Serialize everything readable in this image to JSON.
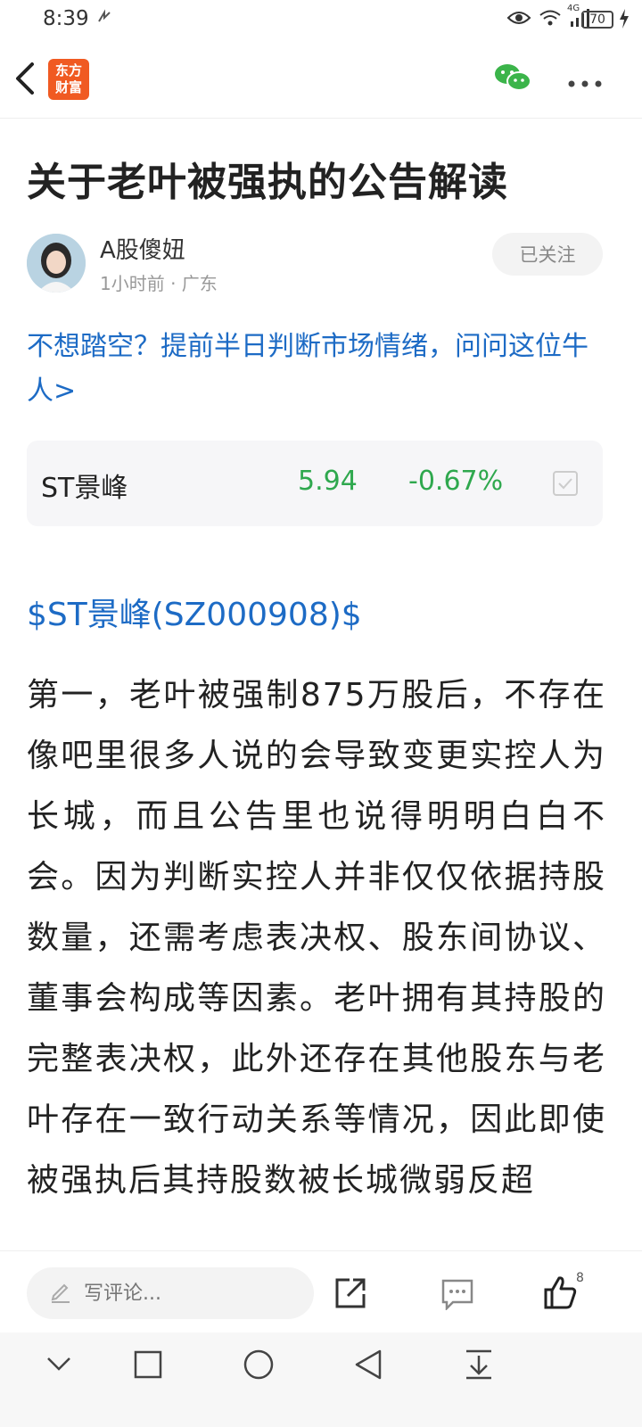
{
  "status_bar": {
    "time": "8:39",
    "network": "4G",
    "battery": "70"
  },
  "nav": {
    "logo_text": "东方\n财富"
  },
  "article": {
    "title": "关于老叶被强执的公告解读",
    "author": {
      "name": "A股傻妞",
      "meta": "1小时前 · 广东",
      "follow_label": "已关注"
    },
    "promo_link": "不想踏空？提前半日判断市场情绪，问问这位牛人>",
    "stock": {
      "name": "ST景峰",
      "price": "5.94",
      "change": "-0.67%"
    },
    "stock_tag": "$ST景峰(SZ000908)$",
    "body": "第一，老叶被强制875万股后，不存在像吧里很多人说的会导致变更实控人为长城，而且公告里也说得明明白白不会。因为判断实控人并非仅仅依据持股数量，还需考虑表决权、股东间协议、董事会构成等因素。老叶拥有其持股的完整表决权，此外还存在其他股东与老叶存在一致行动关系等情况，因此即使被强执后其持股数被长城微弱反超"
  },
  "bottom_bar": {
    "comment_placeholder": "写评论...",
    "like_count": "8"
  },
  "colors": {
    "link_blue": "#1d6bc5",
    "down_green": "#2fa84e",
    "brand_orange": "#f05a22"
  }
}
